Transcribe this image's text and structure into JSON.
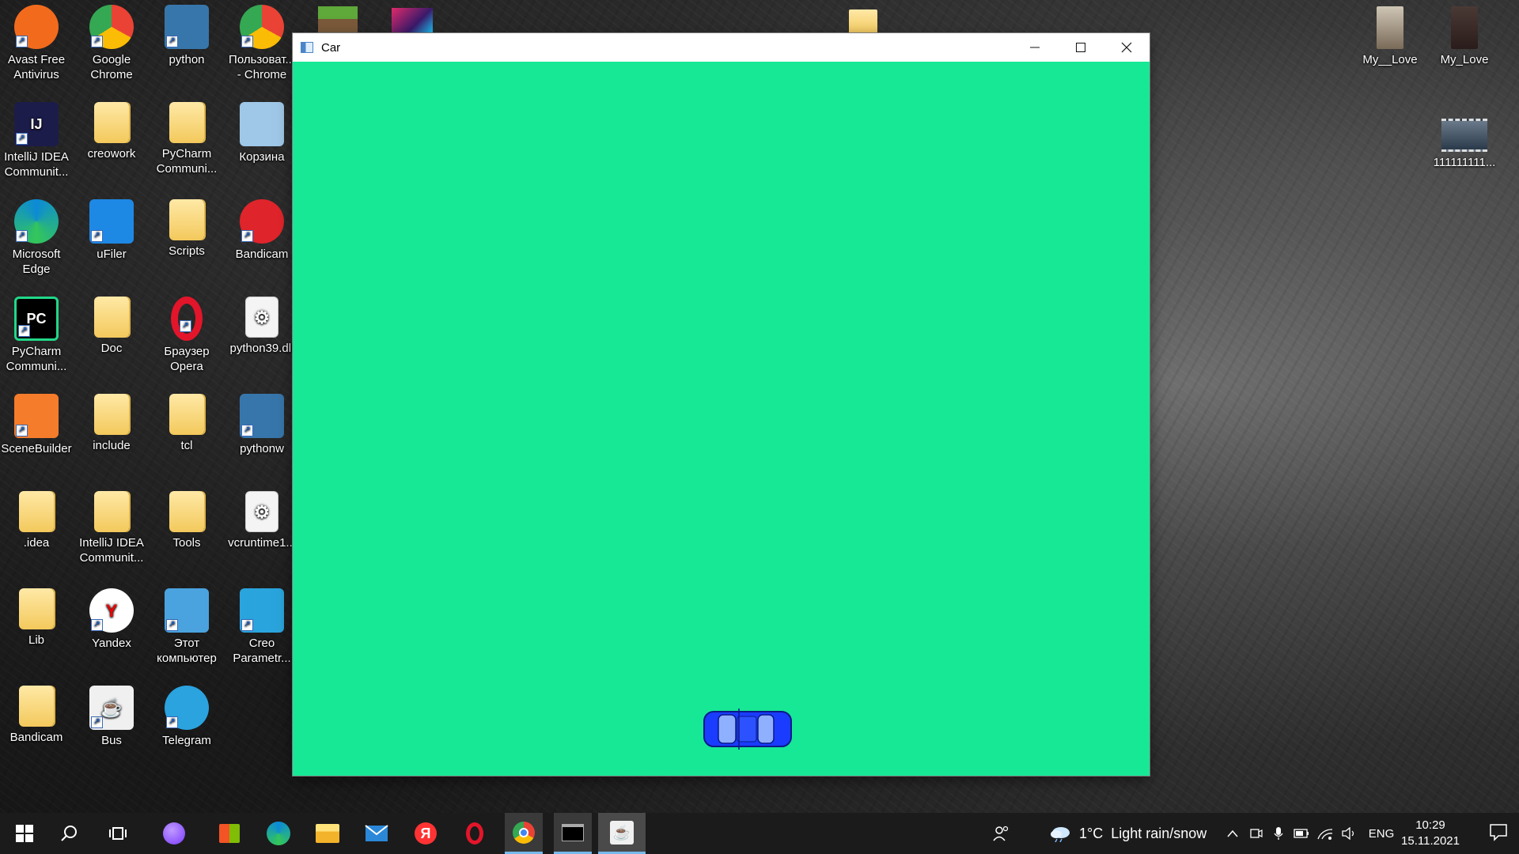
{
  "desktop": {
    "icons_left": [
      {
        "label": "Avast Free Antivirus",
        "icon": "avast-icon",
        "color": "#f26b1d"
      },
      {
        "label": "Google Chrome",
        "icon": "chrome-icon",
        "color": "#4285f4"
      },
      {
        "label": "python",
        "icon": "python-icon",
        "color": "#3776ab"
      },
      {
        "label": "Пользоват... - Chrome",
        "icon": "chrome-user-icon",
        "color": "#4285f4"
      },
      {
        "label": "IntelliJ IDEA Communit...",
        "icon": "intellij-icon",
        "color": "#1c1c4a"
      },
      {
        "label": "creowork",
        "icon": "zip-folder-icon",
        "color": "#f3c95c"
      },
      {
        "label": "PyCharm Communi...",
        "icon": "folder-icon",
        "color": "#f3c95c"
      },
      {
        "label": "Корзина",
        "icon": "recycle-bin-icon",
        "color": "#9fc7e8"
      },
      {
        "label": "Microsoft Edge",
        "icon": "edge-icon",
        "color": "#0c8ad6"
      },
      {
        "label": "uFiler",
        "icon": "ufiler-icon",
        "color": "#1e88e5"
      },
      {
        "label": "Scripts",
        "icon": "folder-icon",
        "color": "#f3c95c"
      },
      {
        "label": "Bandicam",
        "icon": "bandicam-icon",
        "color": "#e0242b"
      },
      {
        "label": "PyCharm Communi...",
        "icon": "pycharm-icon",
        "color": "#21d789"
      },
      {
        "label": "Doc",
        "icon": "folder-icon",
        "color": "#f3c95c"
      },
      {
        "label": "Браузер Opera",
        "icon": "opera-icon",
        "color": "#e3152a"
      },
      {
        "label": "python39.dll",
        "icon": "dll-file-icon",
        "color": "#cccccc"
      },
      {
        "label": "SceneBuilder",
        "icon": "scenebuilder-icon",
        "color": "#f57c2b"
      },
      {
        "label": "include",
        "icon": "folder-icon",
        "color": "#f3c95c"
      },
      {
        "label": "tcl",
        "icon": "folder-icon",
        "color": "#f3c95c"
      },
      {
        "label": "pythonw",
        "icon": "pythonw-icon",
        "color": "#3776ab"
      },
      {
        "label": ".idea",
        "icon": "folder-icon",
        "color": "#f3c95c"
      },
      {
        "label": "IntelliJ IDEA Communit...",
        "icon": "folder-icon",
        "color": "#f3c95c"
      },
      {
        "label": "Tools",
        "icon": "folder-icon",
        "color": "#f3c95c"
      },
      {
        "label": "vcruntime1...",
        "icon": "dll-file-icon",
        "color": "#cccccc"
      },
      {
        "label": "Lib",
        "icon": "lib-folder-icon",
        "color": "#f3c95c"
      },
      {
        "label": "Yandex",
        "icon": "yandex-icon",
        "color": "#ff0000"
      },
      {
        "label": "Этот компьютер",
        "icon": "this-pc-icon",
        "color": "#4aa3df"
      },
      {
        "label": "Creo Parametr...",
        "icon": "creo-icon",
        "color": "#2aa4dd"
      },
      {
        "label": "Bandicam",
        "icon": "bandicam-folder-icon",
        "color": "#f3c95c"
      },
      {
        "label": "Bus",
        "icon": "java-icon",
        "color": "#e76f00"
      },
      {
        "label": "Telegram",
        "icon": "telegram-icon",
        "color": "#2aa3df"
      }
    ],
    "icons_right": [
      {
        "label": "My__Love",
        "icon": "photo-thumbnail-icon"
      },
      {
        "label": "My_Love",
        "icon": "photo-thumbnail-icon"
      },
      {
        "label": "111111111...",
        "icon": "video-thumbnail-icon"
      }
    ]
  },
  "window": {
    "title": "Car",
    "background": "#17e896",
    "car_color": "#1a3cff"
  },
  "taskbar": {
    "weather": "1°C  Light rain/snow",
    "language": "ENG",
    "time": "10:29",
    "date": "15.11.2021"
  }
}
